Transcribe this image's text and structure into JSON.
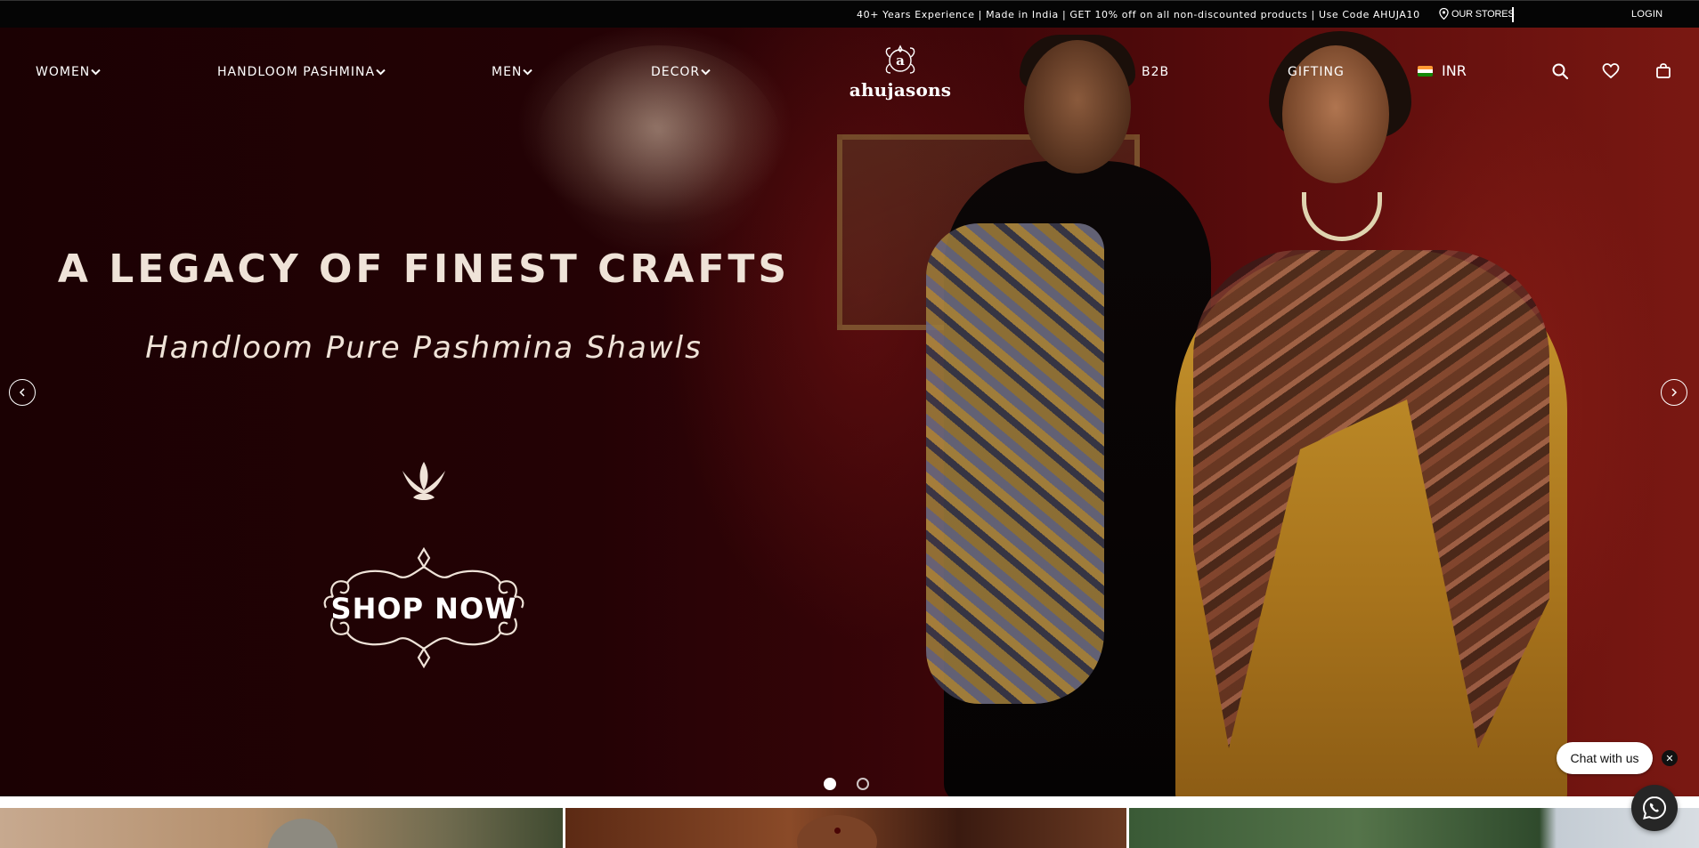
{
  "announcement": {
    "message": "40+ Years Experience | Made in India | GET 10% off on all non-discounted products | Use Code AHUJA10",
    "stores_label": "OUR STORES",
    "login_label": "LOGIN"
  },
  "nav": {
    "left_items": [
      {
        "label": "WOMEN",
        "has_dropdown": true
      },
      {
        "label": "HANDLOOM PASHMINA",
        "has_dropdown": true
      },
      {
        "label": "MEN",
        "has_dropdown": true
      },
      {
        "label": "DECOR",
        "has_dropdown": true
      }
    ],
    "logo_text": "ahujasons",
    "logo_letter": "a",
    "right_items": [
      {
        "label": "B2B"
      },
      {
        "label": "GIFTING"
      }
    ],
    "currency": "INR",
    "icons": [
      "search-icon",
      "heart-icon",
      "bag-icon"
    ]
  },
  "hero": {
    "headline": "A LEGACY OF FINEST CRAFTS",
    "subheadline": "Handloom Pure Pashmina Shawls",
    "cta_label": "SHOP NOW",
    "slides_total": 2,
    "active_slide": 1
  },
  "chat": {
    "label": "Chat with us",
    "close_symbol": "✕"
  },
  "colors": {
    "announcement_bg": "#050505",
    "hero_dark": "#240205",
    "hero_red": "#7a1812",
    "text_light": "#efe3d8"
  }
}
